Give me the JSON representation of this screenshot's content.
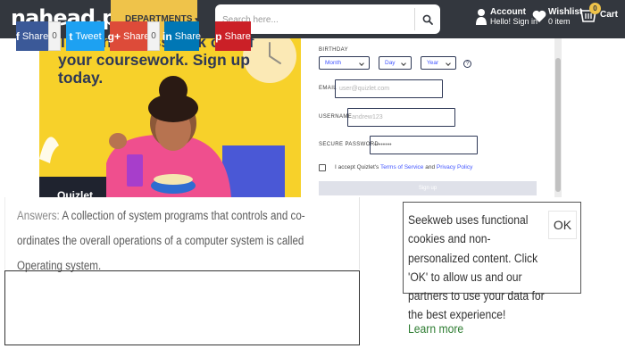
{
  "header": {
    "logo": {
      "name": "nahe",
      "mid": "ad",
      "tld": ".pk"
    },
    "departments_label": "DEPARTMENTS",
    "search_placeholder": "Search here...",
    "account": {
      "title": "Account",
      "subtitle": "Hello! Sign in"
    },
    "wishlist": {
      "title": "Wishlist",
      "subtitle": "0 item"
    },
    "cart": {
      "label": "Cart",
      "count": "0"
    },
    "colors": {
      "bar": "#33373e",
      "accent": "#efc34a"
    }
  },
  "ad": {
    "headline": "Take the guesswork out of your coursework. Sign up today.",
    "brand": "Quizlet",
    "form": {
      "birthday_label": "BIRTHDAY",
      "month": "Month",
      "day": "Day",
      "year": "Year",
      "email_label": "EMAIL",
      "email_placeholder": "user@quizlet.com",
      "username_label": "USERNAME",
      "username_placeholder": "andrew123",
      "password_label": "SECURE PASSWORD",
      "password_value": "••••••••",
      "terms_prefix": "I accept Quizlet's",
      "terms_link": "Terms of Service",
      "terms_and": "and",
      "privacy_link": "Privacy Policy",
      "signup_label": "Sign up"
    }
  },
  "answer": {
    "label": "Answers:",
    "text": "A collection of system programs that controls and co-ordinates the overall operations of a computer system is called Operating system."
  },
  "share": [
    {
      "icon": "f",
      "label": "Share",
      "count": "0",
      "color": "#3b5998"
    },
    {
      "icon": "t",
      "label": "Tweet",
      "count": "",
      "color": "#1da1f2"
    },
    {
      "icon": "g+",
      "label": "Share",
      "count": "0",
      "color": "#dd4b39"
    },
    {
      "icon": "in",
      "label": "Share",
      "count": "",
      "color": "#0077b5"
    },
    {
      "icon": "p",
      "label": "Share",
      "count": "",
      "color": "#cb2027"
    }
  ],
  "cookie": {
    "text": "Seekweb uses functional cookies and non-personalized content. Click 'OK' to allow us and our partners to use your data for the best experience!",
    "link": "Learn more",
    "ok_label": "OK"
  }
}
